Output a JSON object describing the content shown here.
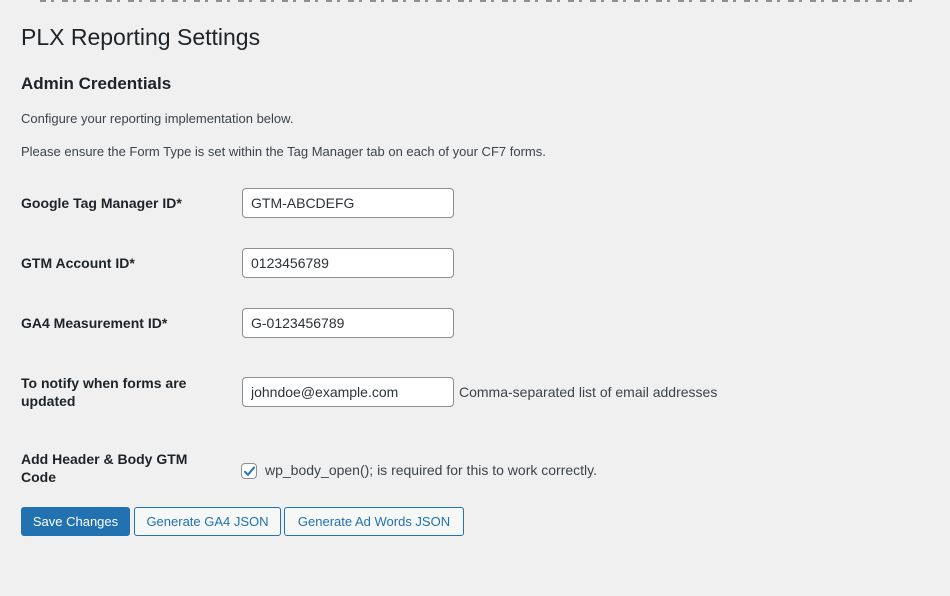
{
  "page": {
    "title": "PLX Reporting Settings",
    "section_title": "Admin Credentials",
    "description_1": "Configure your reporting implementation below.",
    "description_2": "Please ensure the Form Type is set within the Tag Manager tab on each of your CF7 forms."
  },
  "form": {
    "gtm_id": {
      "label": "Google Tag Manager ID*",
      "value": "GTM-ABCDEFG"
    },
    "gtm_account_id": {
      "label": "GTM Account ID*",
      "value": "0123456789"
    },
    "ga4_measurement_id": {
      "label": "GA4 Measurement ID*",
      "value": "G-0123456789"
    },
    "notify_email": {
      "label": "To notify when forms are updated",
      "value": "johndoe@example.com",
      "hint": "Comma-separated list of email addresses"
    },
    "header_body_code": {
      "label": "Add Header & Body GTM Code",
      "checked": true,
      "checkbox_label": "wp_body_open(); is required for this to work correctly."
    }
  },
  "actions": {
    "save": "Save Changes",
    "generate_ga4": "Generate GA4 JSON",
    "generate_adwords": "Generate Ad Words JSON"
  },
  "colors": {
    "background": "#f0f0f1",
    "primary": "#2271b1",
    "text": "#1d2327",
    "muted_text": "#3c434a"
  }
}
